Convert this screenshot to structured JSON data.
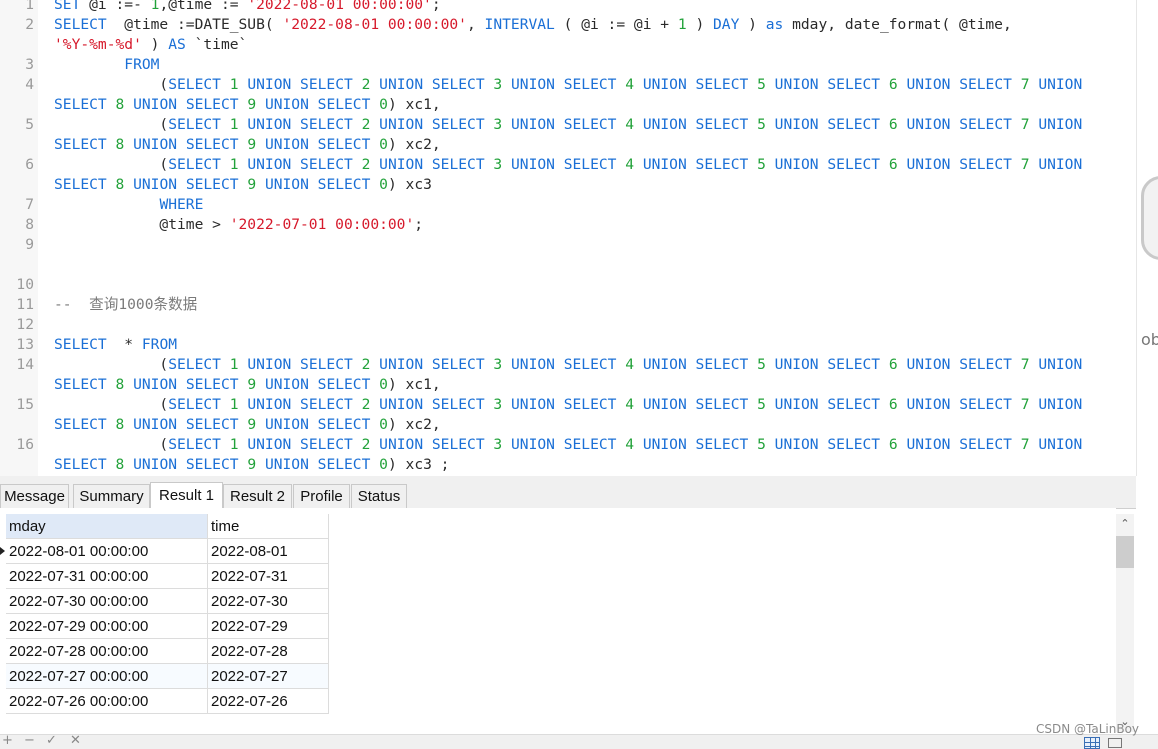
{
  "editor": {
    "lines": [
      {
        "num": "1",
        "tokens": [
          [
            "k",
            "SET"
          ],
          [
            "p",
            " @i :=- "
          ],
          [
            "n",
            "1"
          ],
          [
            "p",
            ",@time := "
          ],
          [
            "s",
            "'2022-08-01 00:00:00'"
          ],
          [
            "p",
            ";"
          ]
        ]
      },
      {
        "num": "2",
        "tokens": [
          [
            "k",
            "SELECT"
          ],
          [
            "p",
            "  @time :=DATE_SUB( "
          ],
          [
            "s",
            "'2022-08-01 00:00:00'"
          ],
          [
            "p",
            ", "
          ],
          [
            "k",
            "INTERVAL"
          ],
          [
            "p",
            " ( @i := @i + "
          ],
          [
            "n",
            "1"
          ],
          [
            "p",
            " ) "
          ],
          [
            "k",
            "DAY"
          ],
          [
            "p",
            " ) "
          ],
          [
            "k",
            "as"
          ],
          [
            "p",
            " mday, date_format( @time,"
          ]
        ]
      },
      {
        "num": "",
        "tokens": [
          [
            "s",
            "'%Y-%m-%d'"
          ],
          [
            "p",
            " ) "
          ],
          [
            "k",
            "AS"
          ],
          [
            "p",
            " `time`"
          ]
        ]
      },
      {
        "num": "3",
        "tokens": [
          [
            "p",
            "        "
          ],
          [
            "k",
            "FROM"
          ]
        ]
      },
      {
        "num": "4",
        "tokens": [
          [
            "p",
            "            ("
          ],
          [
            "k",
            "SELECT"
          ],
          [
            "p",
            " "
          ],
          [
            "n",
            "1"
          ],
          [
            "p",
            " "
          ],
          [
            "k",
            "UNION SELECT"
          ],
          [
            "p",
            " "
          ],
          [
            "n",
            "2"
          ],
          [
            "p",
            " "
          ],
          [
            "k",
            "UNION SELECT"
          ],
          [
            "p",
            " "
          ],
          [
            "n",
            "3"
          ],
          [
            "p",
            " "
          ],
          [
            "k",
            "UNION SELECT"
          ],
          [
            "p",
            " "
          ],
          [
            "n",
            "4"
          ],
          [
            "p",
            " "
          ],
          [
            "k",
            "UNION SELECT"
          ],
          [
            "p",
            " "
          ],
          [
            "n",
            "5"
          ],
          [
            "p",
            " "
          ],
          [
            "k",
            "UNION SELECT"
          ],
          [
            "p",
            " "
          ],
          [
            "n",
            "6"
          ],
          [
            "p",
            " "
          ],
          [
            "k",
            "UNION SELECT"
          ],
          [
            "p",
            " "
          ],
          [
            "n",
            "7"
          ],
          [
            "p",
            " "
          ],
          [
            "k",
            "UNION"
          ]
        ]
      },
      {
        "num": "",
        "tokens": [
          [
            "k",
            "SELECT"
          ],
          [
            "p",
            " "
          ],
          [
            "n",
            "8"
          ],
          [
            "p",
            " "
          ],
          [
            "k",
            "UNION SELECT"
          ],
          [
            "p",
            " "
          ],
          [
            "n",
            "9"
          ],
          [
            "p",
            " "
          ],
          [
            "k",
            "UNION SELECT"
          ],
          [
            "p",
            " "
          ],
          [
            "n",
            "0"
          ],
          [
            "p",
            ") xc1,"
          ]
        ]
      },
      {
        "num": "5",
        "tokens": [
          [
            "p",
            "            ("
          ],
          [
            "k",
            "SELECT"
          ],
          [
            "p",
            " "
          ],
          [
            "n",
            "1"
          ],
          [
            "p",
            " "
          ],
          [
            "k",
            "UNION SELECT"
          ],
          [
            "p",
            " "
          ],
          [
            "n",
            "2"
          ],
          [
            "p",
            " "
          ],
          [
            "k",
            "UNION SELECT"
          ],
          [
            "p",
            " "
          ],
          [
            "n",
            "3"
          ],
          [
            "p",
            " "
          ],
          [
            "k",
            "UNION SELECT"
          ],
          [
            "p",
            " "
          ],
          [
            "n",
            "4"
          ],
          [
            "p",
            " "
          ],
          [
            "k",
            "UNION SELECT"
          ],
          [
            "p",
            " "
          ],
          [
            "n",
            "5"
          ],
          [
            "p",
            " "
          ],
          [
            "k",
            "UNION SELECT"
          ],
          [
            "p",
            " "
          ],
          [
            "n",
            "6"
          ],
          [
            "p",
            " "
          ],
          [
            "k",
            "UNION SELECT"
          ],
          [
            "p",
            " "
          ],
          [
            "n",
            "7"
          ],
          [
            "p",
            " "
          ],
          [
            "k",
            "UNION"
          ]
        ]
      },
      {
        "num": "",
        "tokens": [
          [
            "k",
            "SELECT"
          ],
          [
            "p",
            " "
          ],
          [
            "n",
            "8"
          ],
          [
            "p",
            " "
          ],
          [
            "k",
            "UNION SELECT"
          ],
          [
            "p",
            " "
          ],
          [
            "n",
            "9"
          ],
          [
            "p",
            " "
          ],
          [
            "k",
            "UNION SELECT"
          ],
          [
            "p",
            " "
          ],
          [
            "n",
            "0"
          ],
          [
            "p",
            ") xc2,"
          ]
        ]
      },
      {
        "num": "6",
        "tokens": [
          [
            "p",
            "            ("
          ],
          [
            "k",
            "SELECT"
          ],
          [
            "p",
            " "
          ],
          [
            "n",
            "1"
          ],
          [
            "p",
            " "
          ],
          [
            "k",
            "UNION SELECT"
          ],
          [
            "p",
            " "
          ],
          [
            "n",
            "2"
          ],
          [
            "p",
            " "
          ],
          [
            "k",
            "UNION SELECT"
          ],
          [
            "p",
            " "
          ],
          [
            "n",
            "3"
          ],
          [
            "p",
            " "
          ],
          [
            "k",
            "UNION SELECT"
          ],
          [
            "p",
            " "
          ],
          [
            "n",
            "4"
          ],
          [
            "p",
            " "
          ],
          [
            "k",
            "UNION SELECT"
          ],
          [
            "p",
            " "
          ],
          [
            "n",
            "5"
          ],
          [
            "p",
            " "
          ],
          [
            "k",
            "UNION SELECT"
          ],
          [
            "p",
            " "
          ],
          [
            "n",
            "6"
          ],
          [
            "p",
            " "
          ],
          [
            "k",
            "UNION SELECT"
          ],
          [
            "p",
            " "
          ],
          [
            "n",
            "7"
          ],
          [
            "p",
            " "
          ],
          [
            "k",
            "UNION"
          ]
        ]
      },
      {
        "num": "",
        "tokens": [
          [
            "k",
            "SELECT"
          ],
          [
            "p",
            " "
          ],
          [
            "n",
            "8"
          ],
          [
            "p",
            " "
          ],
          [
            "k",
            "UNION SELECT"
          ],
          [
            "p",
            " "
          ],
          [
            "n",
            "9"
          ],
          [
            "p",
            " "
          ],
          [
            "k",
            "UNION SELECT"
          ],
          [
            "p",
            " "
          ],
          [
            "n",
            "0"
          ],
          [
            "p",
            ") xc3"
          ]
        ]
      },
      {
        "num": "7",
        "tokens": [
          [
            "p",
            "            "
          ],
          [
            "k",
            "WHERE"
          ]
        ]
      },
      {
        "num": "8",
        "tokens": [
          [
            "p",
            "            @time > "
          ],
          [
            "s",
            "'2022-07-01 00:00:00'"
          ],
          [
            "p",
            ";"
          ]
        ]
      },
      {
        "num": "9",
        "tokens": []
      },
      {
        "num": "",
        "tokens": []
      },
      {
        "num": "10",
        "tokens": []
      },
      {
        "num": "11",
        "tokens": [
          [
            "c",
            "--  查询1000条数据"
          ]
        ]
      },
      {
        "num": "12",
        "tokens": []
      },
      {
        "num": "13",
        "tokens": [
          [
            "k",
            "SELECT"
          ],
          [
            "p",
            "  * "
          ],
          [
            "k",
            "FROM"
          ]
        ]
      },
      {
        "num": "14",
        "tokens": [
          [
            "p",
            "            ("
          ],
          [
            "k",
            "SELECT"
          ],
          [
            "p",
            " "
          ],
          [
            "n",
            "1"
          ],
          [
            "p",
            " "
          ],
          [
            "k",
            "UNION SELECT"
          ],
          [
            "p",
            " "
          ],
          [
            "n",
            "2"
          ],
          [
            "p",
            " "
          ],
          [
            "k",
            "UNION SELECT"
          ],
          [
            "p",
            " "
          ],
          [
            "n",
            "3"
          ],
          [
            "p",
            " "
          ],
          [
            "k",
            "UNION SELECT"
          ],
          [
            "p",
            " "
          ],
          [
            "n",
            "4"
          ],
          [
            "p",
            " "
          ],
          [
            "k",
            "UNION SELECT"
          ],
          [
            "p",
            " "
          ],
          [
            "n",
            "5"
          ],
          [
            "p",
            " "
          ],
          [
            "k",
            "UNION SELECT"
          ],
          [
            "p",
            " "
          ],
          [
            "n",
            "6"
          ],
          [
            "p",
            " "
          ],
          [
            "k",
            "UNION SELECT"
          ],
          [
            "p",
            " "
          ],
          [
            "n",
            "7"
          ],
          [
            "p",
            " "
          ],
          [
            "k",
            "UNION"
          ]
        ]
      },
      {
        "num": "",
        "tokens": [
          [
            "k",
            "SELECT"
          ],
          [
            "p",
            " "
          ],
          [
            "n",
            "8"
          ],
          [
            "p",
            " "
          ],
          [
            "k",
            "UNION SELECT"
          ],
          [
            "p",
            " "
          ],
          [
            "n",
            "9"
          ],
          [
            "p",
            " "
          ],
          [
            "k",
            "UNION SELECT"
          ],
          [
            "p",
            " "
          ],
          [
            "n",
            "0"
          ],
          [
            "p",
            ") xc1,"
          ]
        ]
      },
      {
        "num": "15",
        "tokens": [
          [
            "p",
            "            ("
          ],
          [
            "k",
            "SELECT"
          ],
          [
            "p",
            " "
          ],
          [
            "n",
            "1"
          ],
          [
            "p",
            " "
          ],
          [
            "k",
            "UNION SELECT"
          ],
          [
            "p",
            " "
          ],
          [
            "n",
            "2"
          ],
          [
            "p",
            " "
          ],
          [
            "k",
            "UNION SELECT"
          ],
          [
            "p",
            " "
          ],
          [
            "n",
            "3"
          ],
          [
            "p",
            " "
          ],
          [
            "k",
            "UNION SELECT"
          ],
          [
            "p",
            " "
          ],
          [
            "n",
            "4"
          ],
          [
            "p",
            " "
          ],
          [
            "k",
            "UNION SELECT"
          ],
          [
            "p",
            " "
          ],
          [
            "n",
            "5"
          ],
          [
            "p",
            " "
          ],
          [
            "k",
            "UNION SELECT"
          ],
          [
            "p",
            " "
          ],
          [
            "n",
            "6"
          ],
          [
            "p",
            " "
          ],
          [
            "k",
            "UNION SELECT"
          ],
          [
            "p",
            " "
          ],
          [
            "n",
            "7"
          ],
          [
            "p",
            " "
          ],
          [
            "k",
            "UNION"
          ]
        ]
      },
      {
        "num": "",
        "tokens": [
          [
            "k",
            "SELECT"
          ],
          [
            "p",
            " "
          ],
          [
            "n",
            "8"
          ],
          [
            "p",
            " "
          ],
          [
            "k",
            "UNION SELECT"
          ],
          [
            "p",
            " "
          ],
          [
            "n",
            "9"
          ],
          [
            "p",
            " "
          ],
          [
            "k",
            "UNION SELECT"
          ],
          [
            "p",
            " "
          ],
          [
            "n",
            "0"
          ],
          [
            "p",
            ") xc2,"
          ]
        ]
      },
      {
        "num": "16",
        "tokens": [
          [
            "p",
            "            ("
          ],
          [
            "k",
            "SELECT"
          ],
          [
            "p",
            " "
          ],
          [
            "n",
            "1"
          ],
          [
            "p",
            " "
          ],
          [
            "k",
            "UNION SELECT"
          ],
          [
            "p",
            " "
          ],
          [
            "n",
            "2"
          ],
          [
            "p",
            " "
          ],
          [
            "k",
            "UNION SELECT"
          ],
          [
            "p",
            " "
          ],
          [
            "n",
            "3"
          ],
          [
            "p",
            " "
          ],
          [
            "k",
            "UNION SELECT"
          ],
          [
            "p",
            " "
          ],
          [
            "n",
            "4"
          ],
          [
            "p",
            " "
          ],
          [
            "k",
            "UNION SELECT"
          ],
          [
            "p",
            " "
          ],
          [
            "n",
            "5"
          ],
          [
            "p",
            " "
          ],
          [
            "k",
            "UNION SELECT"
          ],
          [
            "p",
            " "
          ],
          [
            "n",
            "6"
          ],
          [
            "p",
            " "
          ],
          [
            "k",
            "UNION SELECT"
          ],
          [
            "p",
            " "
          ],
          [
            "n",
            "7"
          ],
          [
            "p",
            " "
          ],
          [
            "k",
            "UNION"
          ]
        ]
      },
      {
        "num": "",
        "tokens": [
          [
            "k",
            "SELECT"
          ],
          [
            "p",
            " "
          ],
          [
            "n",
            "8"
          ],
          [
            "p",
            " "
          ],
          [
            "k",
            "UNION SELECT"
          ],
          [
            "p",
            " "
          ],
          [
            "n",
            "9"
          ],
          [
            "p",
            " "
          ],
          [
            "k",
            "UNION SELECT"
          ],
          [
            "p",
            " "
          ],
          [
            "n",
            "0"
          ],
          [
            "p",
            ") xc3 ;"
          ]
        ]
      }
    ]
  },
  "side_text": "ob",
  "tabs": [
    "Message",
    "Summary",
    "Result 1",
    "Result 2",
    "Profile",
    "Status"
  ],
  "active_tab": "Result 1",
  "results": {
    "columns": [
      "mday",
      "time"
    ],
    "rows": [
      [
        "2022-08-01 00:00:00",
        "2022-08-01"
      ],
      [
        "2022-07-31 00:00:00",
        "2022-07-31"
      ],
      [
        "2022-07-30 00:00:00",
        "2022-07-30"
      ],
      [
        "2022-07-29 00:00:00",
        "2022-07-29"
      ],
      [
        "2022-07-28 00:00:00",
        "2022-07-28"
      ],
      [
        "2022-07-27 00:00:00",
        "2022-07-27"
      ],
      [
        "2022-07-26 00:00:00",
        "2022-07-26"
      ]
    ]
  },
  "statusbar": {
    "icons": [
      "+",
      "−",
      "✓",
      "✕"
    ]
  },
  "watermark": "CSDN @TaLinBoy"
}
